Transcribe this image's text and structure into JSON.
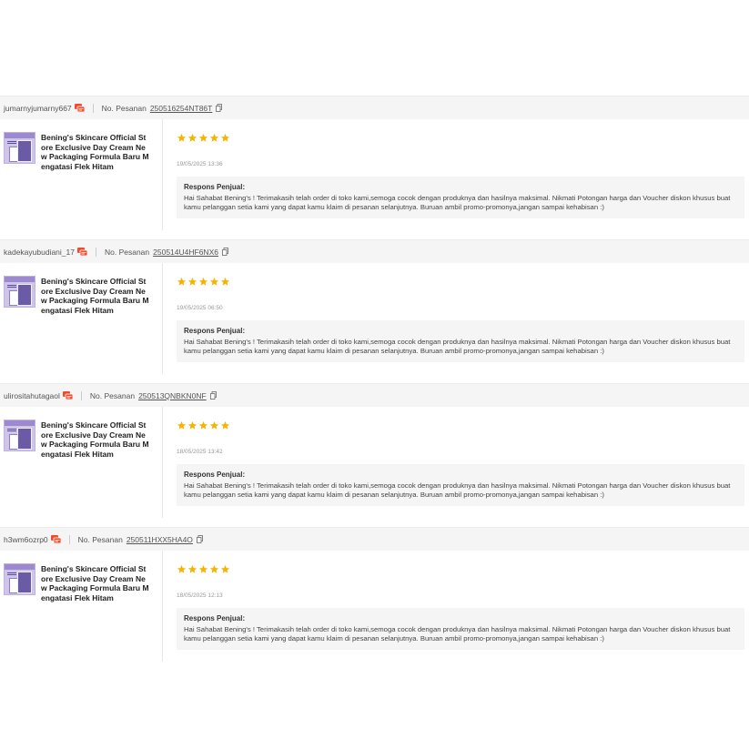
{
  "order_label": "No. Pesanan",
  "response_title": "Respons Penjual:",
  "colors": {
    "star": "#f6b400",
    "chat": "#ee4d2d"
  },
  "reviews": [
    {
      "username": "jumarnyjumarny667",
      "order_number": "250516254NT86T",
      "product_name": "Bening's Skincare Official Store Exclusive Day Cream New Packaging Formula Baru Mengatasi Flek Hitam",
      "rating": 5,
      "date": "19/05/2025 13:36",
      "response": "Hai Sahabat Bening's ! Terimakasih telah order di toko kami,semoga cocok dengan produknya dan hasilnya maksimal. Nikmati Potongan harga dan Voucher diskon khusus buat kamu pelanggan setia kami yang dapat kamu klaim di pesanan selanjutnya. Buruan ambil promo-promonya,jangan sampai kehabisan :)"
    },
    {
      "username": "kadekayubudiani_17",
      "order_number": "250514U4HF6NX6",
      "product_name": "Bening's Skincare Official Store Exclusive Day Cream New Packaging Formula Baru Mengatasi Flek Hitam",
      "rating": 5,
      "date": "19/05/2025 06:50",
      "response": "Hai Sahabat Bening's ! Terimakasih telah order di toko kami,semoga cocok dengan produknya dan hasilnya maksimal. Nikmati Potongan harga dan Voucher diskon khusus buat kamu pelanggan setia kami yang dapat kamu klaim di pesanan selanjutnya. Buruan ambil promo-promonya,jangan sampai kehabisan :)"
    },
    {
      "username": "ulirositahutagaol",
      "order_number": "250513QNBKN0NF",
      "product_name": "Bening's Skincare Official Store Exclusive Day Cream New Packaging Formula Baru Mengatasi Flek Hitam",
      "rating": 5,
      "date": "18/05/2025 13:42",
      "response": "Hai Sahabat Bening's ! Terimakasih telah order di toko kami,semoga cocok dengan produknya dan hasilnya maksimal. Nikmati Potongan harga dan Voucher diskon khusus buat kamu pelanggan setia kami yang dapat kamu klaim di pesanan selanjutnya. Buruan ambil promo-promonya,jangan sampai kehabisan :)"
    },
    {
      "username": "h3wm6ozrp0",
      "order_number": "250511HXX5HA4O",
      "product_name": "Bening's Skincare Official Store Exclusive Day Cream New Packaging Formula Baru Mengatasi Flek Hitam",
      "rating": 5,
      "date": "18/05/2025 12:13",
      "response": "Hai Sahabat Bening's ! Terimakasih telah order di toko kami,semoga cocok dengan produknya dan hasilnya maksimal. Nikmati Potongan harga dan Voucher diskon khusus buat kamu pelanggan setia kami yang dapat kamu klaim di pesanan selanjutnya. Buruan ambil promo-promonya,jangan sampai kehabisan :)"
    }
  ]
}
